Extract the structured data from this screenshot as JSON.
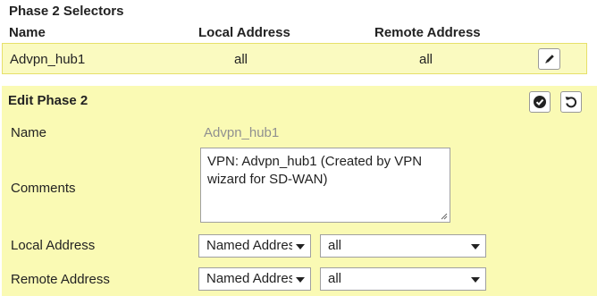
{
  "selectors": {
    "title": "Phase 2 Selectors",
    "columns": {
      "name": "Name",
      "local": "Local Address",
      "remote": "Remote Address"
    },
    "row": {
      "name": "Advpn_hub1",
      "local": "all",
      "remote": "all"
    }
  },
  "edit": {
    "title": "Edit Phase 2",
    "fields": {
      "name_label": "Name",
      "name_value": "Advpn_hub1",
      "comments_label": "Comments",
      "comments_value": "VPN: Advpn_hub1 (Created by VPN wizard for SD-WAN)",
      "local_label": "Local Address",
      "local_type": "Named Address",
      "local_value": "all",
      "remote_label": "Remote Address",
      "remote_type": "Named Address",
      "remote_value": "all"
    }
  },
  "icons": {
    "edit": "pencil-icon",
    "apply": "check-circle-icon",
    "revert": "undo-icon",
    "dropdown": "chevron-down-icon"
  },
  "colors": {
    "selected_row": "#fafac0",
    "edit_panel": "#fafab4",
    "muted_text": "#909090"
  }
}
